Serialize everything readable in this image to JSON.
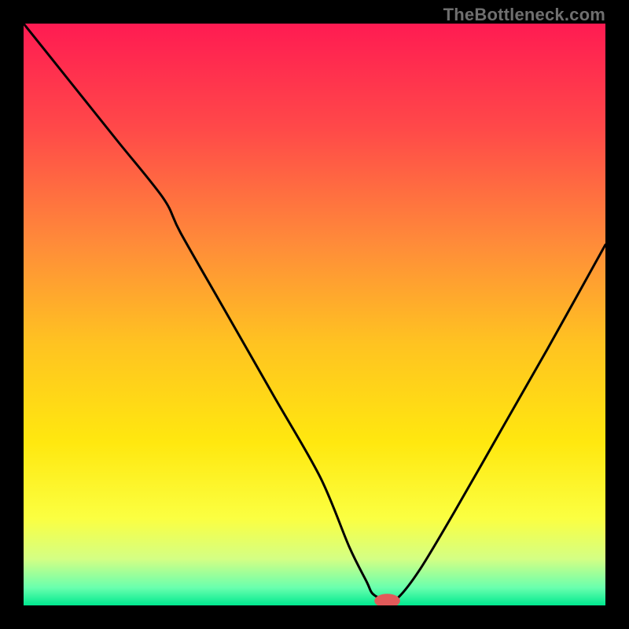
{
  "watermark": "TheBottleneck.com",
  "chart_data": {
    "type": "line",
    "title": "",
    "xlabel": "",
    "ylabel": "",
    "xlim": [
      0,
      100
    ],
    "ylim": [
      0,
      100
    ],
    "grid": false,
    "legend": false,
    "background_gradient": {
      "stops": [
        {
          "offset": 0.0,
          "color": "#ff1b52"
        },
        {
          "offset": 0.18,
          "color": "#ff4949"
        },
        {
          "offset": 0.38,
          "color": "#ff8c39"
        },
        {
          "offset": 0.55,
          "color": "#ffc321"
        },
        {
          "offset": 0.72,
          "color": "#ffe80f"
        },
        {
          "offset": 0.85,
          "color": "#fbff41"
        },
        {
          "offset": 0.92,
          "color": "#d4ff84"
        },
        {
          "offset": 0.97,
          "color": "#68ffae"
        },
        {
          "offset": 1.0,
          "color": "#00e98f"
        }
      ]
    },
    "series": [
      {
        "name": "bottleneck-curve",
        "color": "#000000",
        "x": [
          0,
          8,
          16,
          24,
          27,
          35,
          43,
          51,
          56,
          59,
          60,
          62,
          64,
          68,
          74,
          82,
          90,
          100
        ],
        "y": [
          100,
          90,
          80,
          70,
          64,
          50,
          36,
          22,
          10,
          4,
          2,
          1,
          1,
          6,
          16,
          30,
          44,
          62
        ]
      }
    ],
    "marker": {
      "name": "optimal-point",
      "x": 62.5,
      "y": 0.8,
      "rx": 2.2,
      "ry": 1.2,
      "fill": "#e15a5a"
    }
  }
}
